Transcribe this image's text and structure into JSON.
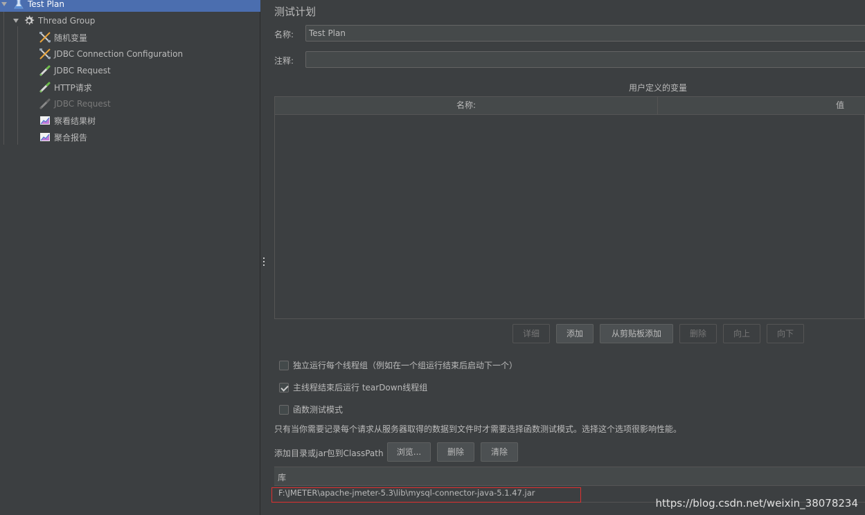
{
  "tree": {
    "items": [
      {
        "label": "Test Plan",
        "icon": "test-plan-icon"
      },
      {
        "label": "Thread Group",
        "icon": "gear-icon"
      },
      {
        "label": "随机变量",
        "icon": "config-element-icon"
      },
      {
        "label": "JDBC Connection Configuration",
        "icon": "config-element-icon"
      },
      {
        "label": "JDBC Request",
        "icon": "sampler-pipette-icon"
      },
      {
        "label": "HTTP请求",
        "icon": "sampler-pipette-icon"
      },
      {
        "label": "JDBC Request",
        "icon": "sampler-pipette-icon"
      },
      {
        "label": "察看结果树",
        "icon": "listener-graph-icon"
      },
      {
        "label": "聚合报告",
        "icon": "listener-graph-icon"
      }
    ]
  },
  "main": {
    "title": "测试计划",
    "name_label": "名称:",
    "name_value": "Test Plan",
    "comment_label": "注释:",
    "comment_value": "",
    "vars_title": "用户定义的变量",
    "vars_columns": [
      "名称:",
      "值"
    ],
    "buttons": {
      "detail": "详细",
      "add": "添加",
      "add_clipboard": "从剪贴板添加",
      "delete": "删除",
      "up": "向上",
      "down": "向下"
    },
    "checkboxes": [
      {
        "label": "独立运行每个线程组（例如在一个组运行结束后启动下一个）",
        "checked": false
      },
      {
        "label": "主线程结束后运行 tearDown线程组",
        "checked": true
      },
      {
        "label": "函数测试模式",
        "checked": false
      }
    ],
    "functional_note": "只有当你需要记录每个请求从服务器取得的数据到文件时才需要选择函数测试模式。选择这个选项很影响性能。",
    "classpath_label": "添加目录或jar包到ClassPath",
    "classpath_buttons": {
      "browse": "浏览...",
      "delete": "删除",
      "clear": "清除"
    },
    "lib_header": "库",
    "lib_rows": [
      "F:\\JMETER\\apache-jmeter-5.3\\lib\\mysql-connector-java-5.1.47.jar"
    ]
  },
  "watermark": "https://blog.csdn.net/weixin_38078234"
}
